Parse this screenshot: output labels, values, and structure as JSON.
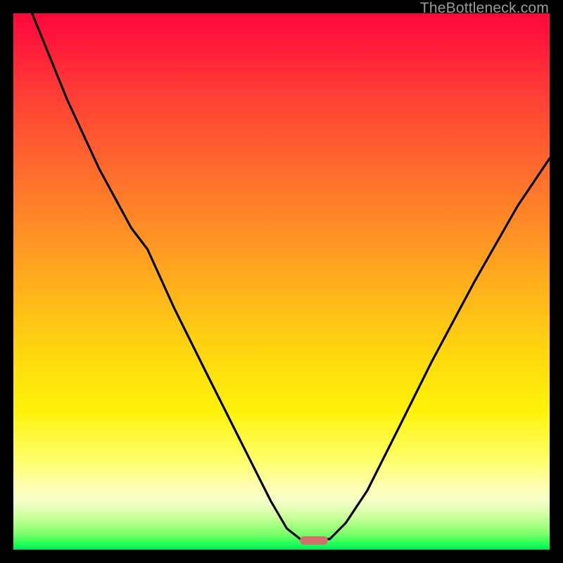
{
  "watermark": "TheBottleneck.com",
  "colors": {
    "frame": "#000000",
    "curve": "#000000",
    "marker": "#d1716b",
    "watermark_text": "#9a9a9a"
  },
  "chart_data": {
    "type": "line",
    "title": "",
    "xlabel": "",
    "ylabel": "",
    "xlim": [
      0,
      100
    ],
    "ylim": [
      0,
      100
    ],
    "grid": false,
    "legend": false,
    "note": "Single black V-shaped bottleneck curve over a vertical red→yellow→green heat gradient. Values below are percentages of the plot area (0 = left/top edge of gradient, 100 = right/bottom). y is the vertical position of the curve measured from the TOP of the gradient (so larger y = lower on screen = closer to green/optimal).",
    "series": [
      {
        "name": "bottleneck-curve",
        "x": [
          3.5,
          10,
          16,
          22,
          25,
          30,
          36,
          42,
          48,
          51,
          53.5,
          56,
          59,
          62,
          66,
          72,
          78,
          86,
          94,
          100
        ],
        "y": [
          0,
          16,
          29,
          40,
          44,
          55,
          67,
          79,
          91,
          96,
          98,
          98,
          98,
          95,
          89,
          77,
          65,
          50,
          36,
          27
        ]
      }
    ],
    "marker": {
      "note": "Small rounded salmon rectangle marking the curve minimum (optimal point) near the bottom green band.",
      "x_center_pct": 56,
      "y_center_pct": 98.3,
      "width_pct": 5.2,
      "height_pct": 1.6
    }
  }
}
